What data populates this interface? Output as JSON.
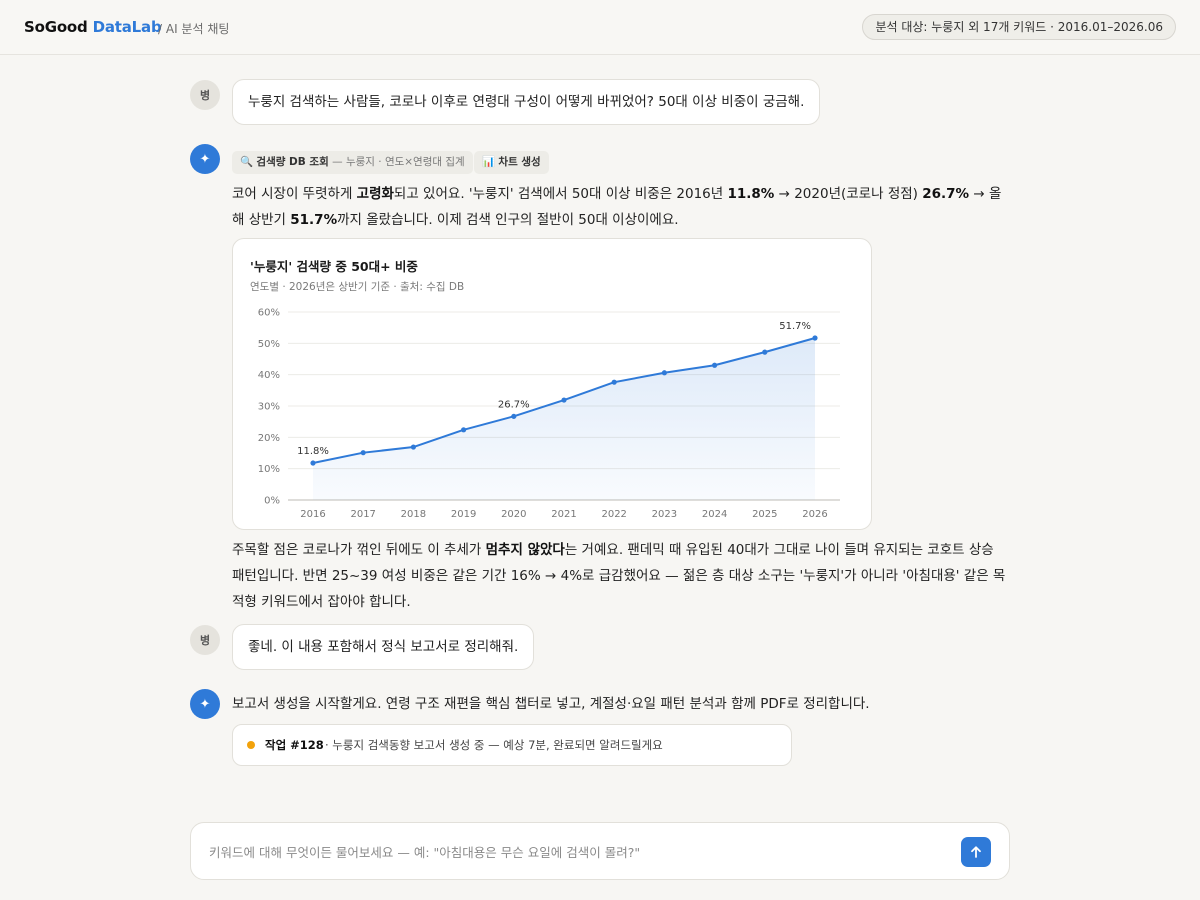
{
  "header": {
    "brand_main": "SoGood",
    "brand_accent": "DataLab",
    "subtitle": "/ AI 분석 채팅",
    "scope": "분석 대상: 누룽지 외 17개 키워드 · 2016.01–2026.06"
  },
  "messages": {
    "user1": {
      "avatar": "병",
      "text": "누룽지 검색하는 사람들, 코로나 이후로 연령대 구성이 어떻게 바뀌었어? 50대 이상 비중이 궁금해."
    },
    "ai1": {
      "avatar": "✦",
      "tool1_icon": "🔍",
      "tool1_name": "검색량 DB 조회",
      "tool1_detail": "— 누룽지 · 연도×연령대 집계",
      "tool2_icon": "📊",
      "tool2_name": "차트 생성",
      "p1_a": "코어 시장이 뚜렷하게 ",
      "p1_b": "고령화",
      "p1_c": "되고 있어요. '누룽지' 검색에서 50대 이상 비중은 2016년 ",
      "p1_d": "11.8%",
      "p1_e": " → 2020년(코로나 정점) ",
      "p1_f": "26.7%",
      "p1_g": " → 올해 상반기 ",
      "p1_h": "51.7%",
      "p1_i": "까지 올랐습니다. 이제 검색 인구의 절반이 50대 이상이에요.",
      "p2_a": "주목할 점은 코로나가 꺾인 뒤에도 이 추세가 ",
      "p2_b": "멈추지 않았다",
      "p2_c": "는 거예요. 팬데믹 때 유입된 40대가 그대로 나이 들며 유지되는 코호트 상승 패턴입니다. 반면 25~39 여성 비중은 같은 기간 16% → 4%로 급감했어요 — 젊은 층 대상 소구는 '누룽지'가 아니라 '아침대용' 같은 목적형 키워드에서 잡아야 합니다."
    },
    "user2": {
      "avatar": "병",
      "text": "좋네. 이 내용 포함해서 정식 보고서로 정리해줘."
    },
    "ai2": {
      "avatar": "✦",
      "text": "보고서 생성을 시작할게요. 연령 구조 재편을 핵심 챕터로 넣고, 계절성·요일 패턴 분석과 함께 PDF로 정리합니다.",
      "task_id": "작업 #128",
      "task_desc": "· 누룽지 검색동향 보고서 생성 중 — 예상 7분, 완료되면 알려드릴게요"
    }
  },
  "chart_data": {
    "type": "area",
    "title": "'누룽지' 검색량 중 50대+ 비중",
    "subtitle": "연도별 · 2026년은 상반기 기준 · 출처: 수집 DB",
    "xlabel": "",
    "ylabel": "",
    "x": [
      "2016",
      "2017",
      "2018",
      "2019",
      "2020",
      "2021",
      "2022",
      "2023",
      "2024",
      "2025",
      "2026"
    ],
    "values": [
      11.8,
      15.1,
      16.9,
      22.4,
      26.7,
      31.9,
      37.6,
      40.6,
      43.0,
      47.2,
      51.7
    ],
    "ylim": [
      0,
      60
    ],
    "yticks": [
      "0%",
      "10%",
      "20%",
      "30%",
      "40%",
      "50%",
      "60%"
    ],
    "annotations": [
      {
        "x": "2016",
        "label": "11.8%"
      },
      {
        "x": "2020",
        "label": "26.7%"
      },
      {
        "x": "2026",
        "label": "51.7%"
      }
    ],
    "grid": true,
    "line_color": "#2f7ad8"
  },
  "composer": {
    "placeholder": "키워드에 대해 무엇이든 물어보세요 — 예: \"아침대용은 무슨 요일에 검색이 몰려?\"",
    "value": "",
    "send_icon": "arrow-up-icon"
  }
}
